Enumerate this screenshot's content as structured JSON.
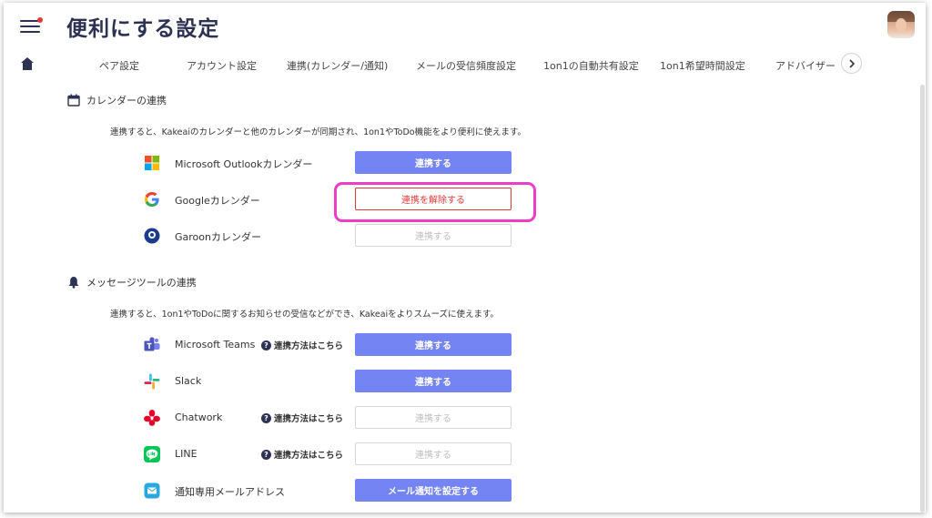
{
  "header": {
    "title": "便利にする設定"
  },
  "tabs": [
    {
      "label": "ペア設定"
    },
    {
      "label": "アカウント設定"
    },
    {
      "label": "連携(カレンダー/通知)"
    },
    {
      "label": "メールの受信頻度設定"
    },
    {
      "label": "1on1の自動共有設定"
    },
    {
      "label": "1on1希望時間設定"
    },
    {
      "label": "アドバイザー"
    }
  ],
  "calendar_section": {
    "heading": "カレンダーの連携",
    "description": "連携すると、Kakeaiのカレンダーと他のカレンダーが同期され、1on1やToDo機能をより便利に使えます。",
    "items": [
      {
        "name": "Microsoft Outlookカレンダー",
        "icon": "microsoft-icon",
        "button": "連携する",
        "state": "available"
      },
      {
        "name": "Googleカレンダー",
        "icon": "google-icon",
        "button": "連携を解除する",
        "state": "connected"
      },
      {
        "name": "Garoonカレンダー",
        "icon": "garoon-icon",
        "button": "連携する",
        "state": "disabled"
      }
    ]
  },
  "message_section": {
    "heading": "メッセージツールの連携",
    "description": "連携すると、1on1やToDoに関するお知らせの受信などができ、Kakeaiをよりスムーズに使えます。",
    "help_label": "連携方法はこちら",
    "items": [
      {
        "name": "Microsoft Teams",
        "icon": "teams-icon",
        "button": "連携する",
        "state": "available",
        "help": true
      },
      {
        "name": "Slack",
        "icon": "slack-icon",
        "button": "連携する",
        "state": "available",
        "help": false
      },
      {
        "name": "Chatwork",
        "icon": "chatwork-icon",
        "button": "連携する",
        "state": "disabled",
        "help": true
      },
      {
        "name": "LINE",
        "icon": "line-icon",
        "button": "連携する",
        "state": "disabled",
        "help": true
      },
      {
        "name": "通知専用メールアドレス",
        "icon": "mail-icon",
        "button": "メール通知を設定する",
        "state": "available",
        "help": false
      }
    ]
  },
  "colors": {
    "primary": "#7484f2",
    "danger": "#e53935",
    "highlight": "#ee3dc6",
    "title": "#2d3252"
  }
}
